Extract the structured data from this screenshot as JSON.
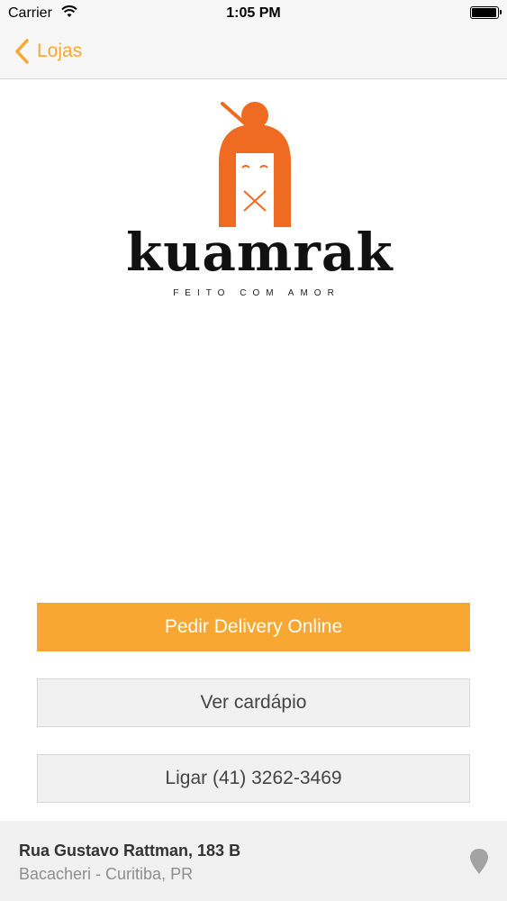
{
  "status_bar": {
    "carrier": "Carrier",
    "time": "1:05 PM",
    "battery_level": 1.0
  },
  "nav": {
    "back_label": "Lojas",
    "back_icon": "chevron-left-icon"
  },
  "logo": {
    "wordmark": "kuamrak",
    "tagline": "FEITO COM AMOR"
  },
  "actions": {
    "delivery": "Pedir Delivery Online",
    "menu": "Ver cardápio",
    "call": "Ligar (41) 3262-3469"
  },
  "address": {
    "street": "Rua Gustavo Rattman, 183 B",
    "district": "Bacacheri - Curitiba, PR",
    "icon": "map-pin-icon"
  },
  "colors": {
    "accent": "#f9a733",
    "mascot": "#ee6b21",
    "secondary_button": "#f1f1f1"
  }
}
